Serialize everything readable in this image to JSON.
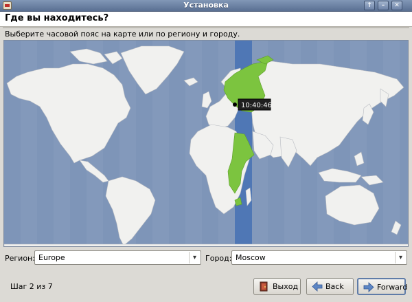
{
  "window": {
    "title": "Установка",
    "controls": [
      "↑",
      "–",
      "✕"
    ]
  },
  "page": {
    "heading": "Где вы находитесь?",
    "instructions": "Выберите часовой пояс на карте или по региону и городу."
  },
  "map": {
    "clock_label": "10:40:46",
    "selected_city": "Moscow",
    "land_color": "#f1f1ef",
    "water_color": "#8399bb",
    "highlight_land_color": "#7cc43f",
    "highlight_band_color": "#4f77b5"
  },
  "selectors": {
    "region_label": "Регион:",
    "region_value": "Europe",
    "city_label": "Город:",
    "city_value": "Moscow"
  },
  "footer": {
    "step_text": "Шаг 2 из 7",
    "quit_label": "Выход",
    "back_label": "Back",
    "forward_label": "Forward"
  }
}
